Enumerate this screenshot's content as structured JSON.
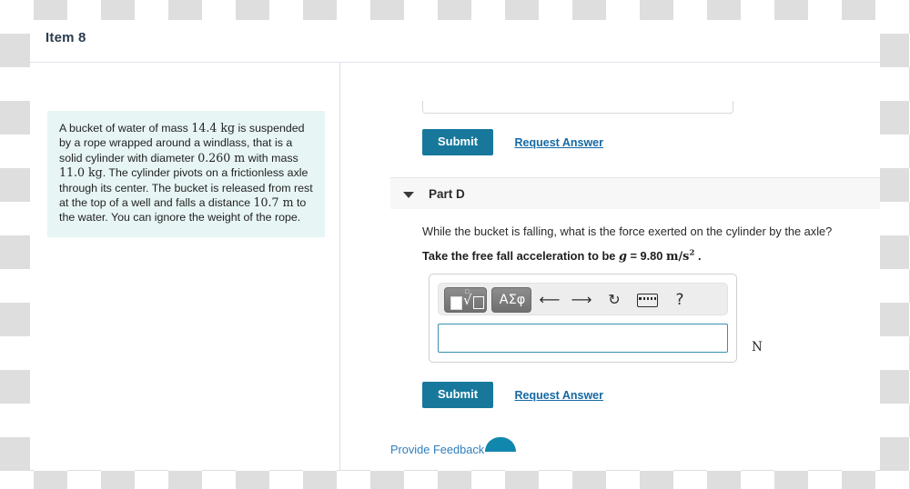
{
  "header": {
    "item_title": "Item 8"
  },
  "problem": {
    "text_parts": {
      "p1": "A bucket of water of mass ",
      "mass1": "14.4 kg",
      "p2": " is suspended by a rope wrapped around a windlass, that is a solid cylinder with diameter ",
      "diameter": "0.260 m",
      "p3": " with mass ",
      "mass2": "11.0 kg",
      "p4": ". The cylinder pivots on a frictionless axle through its center. The bucket is released from rest at the top of a well and falls a distance ",
      "distance": "10.7 m",
      "p5": " to the water. You can ignore the weight of the rope."
    },
    "full_text": "A bucket of water of mass 14.4 kg is suspended by a rope wrapped around a windlass, that is a solid cylinder with diameter 0.260 m with mass 11.0 kg . The cylinder pivots on a frictionless axle through its center. The bucket is released from rest at the top of a well and falls a distance 10.7 m to the water. You can ignore the weight of the rope."
  },
  "previous_part": {
    "submit_label": "Submit",
    "request_answer_label": "Request Answer"
  },
  "part_d": {
    "label": "Part D",
    "expanded": true,
    "question": "While the bucket is falling, what is the force exerted on the cylinder by the axle?",
    "hint_prefix": "Take the free fall acceleration to be ",
    "hint_var": "g",
    "hint_eq": " = 9.80 ",
    "hint_unit": "m/s",
    "hint_exp": "2",
    "hint_suffix": " .",
    "answer_value": "",
    "answer_placeholder": "",
    "unit": "N",
    "submit_label": "Submit",
    "request_answer_label": "Request Answer",
    "toolbar": {
      "templates_tooltip": "Templates",
      "greek_label": "ΑΣφ",
      "undo_glyph": "↰",
      "redo_glyph": "↱",
      "reset_glyph": "↻",
      "help_glyph": "?"
    }
  },
  "footer": {
    "provide_feedback_label": "Provide Feedback"
  },
  "colors": {
    "accent_teal": "#17789c",
    "link_blue": "#1569a3",
    "feedback_blue": "#2e7fbd",
    "problem_box_bg": "#e7f5f4",
    "part_band_bg": "#f7f7f7",
    "input_border": "#3a8fb0"
  }
}
